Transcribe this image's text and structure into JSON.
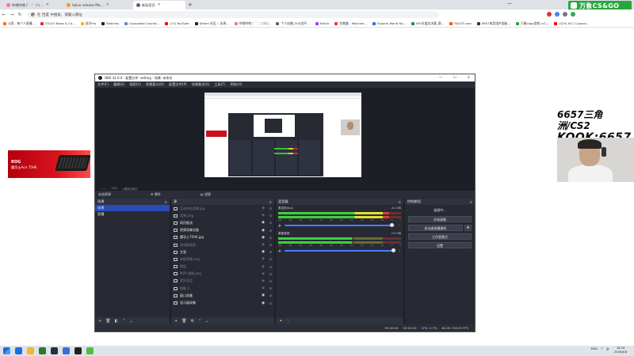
{
  "browser": {
    "tabs": [
      {
        "title": "哔哩哔哩 (゜-゜)つロ 干杯~-bilibili",
        "favicon_color": "#fb7299",
        "active": false
      },
      {
        "title": "Valve release Major identit...",
        "favicon_color": "#f0a01e",
        "active": false
      },
      {
        "title": "新标签页",
        "favicon_color": "#5f6368",
        "active": true
      }
    ],
    "omnibox_placeholder": "在 百度 中搜索，或输入网址",
    "bookmarks": [
      {
        "label": "斗鱼 - 每个人直播...",
        "color": "#ff6a00"
      },
      {
        "label": "CS:GO News & Co...",
        "color": "#d83131"
      },
      {
        "label": "虎牙Pro",
        "color": "#f6b600"
      },
      {
        "label": "Matches",
        "color": "#222222"
      },
      {
        "label": "Liquipedia Counte...",
        "color": "#6e89b6"
      },
      {
        "label": "(13) YouTube",
        "color": "#ff0000"
      },
      {
        "label": "Steam 社区 :: 本周...",
        "color": "#1b2838"
      },
      {
        "label": "哔哩哔哩 (゜-゜)つロ...",
        "color": "#fb7299"
      },
      {
        "label": "个人站播_SOS战平...",
        "color": "#666666"
      },
      {
        "label": "Twitch",
        "color": "#9146ff"
      },
      {
        "label": "完美趣 - Machine...",
        "color": "#e23b3b"
      },
      {
        "label": "Esports World Ra...",
        "color": "#3a6fd8"
      },
      {
        "label": "KPL年度总决赛_赛...",
        "color": "#2e8b57"
      },
      {
        "label": "FACEIT.com",
        "color": "#ff5500"
      },
      {
        "label": "6657电竞组件面板...",
        "color": "#333333"
      },
      {
        "label": "万象cogs游戏 (n2...",
        "color": "#2aa640"
      },
      {
        "label": "(425) HLC Cuprosi...",
        "color": "#ff0000"
      }
    ]
  },
  "overlay": {
    "site_logo": "万象CS&GO",
    "ad_brand": "ROG",
    "ad_text": "魔导士Ace 75HE",
    "stream_title_line1": "6657三角洲/CS2",
    "stream_title_line2": "KOOK:6657"
  },
  "obs": {
    "title": "OBS 32.0.4 - 配置文件: setting - 场景: 未命名",
    "menu": [
      "文件(F)",
      "编辑(E)",
      "视图(V)",
      "停靠窗口(D)",
      "配置文件(P)",
      "场景集合(S)",
      "工具(T)",
      "帮助(H)"
    ],
    "preview_footer": [
      "——",
      "16%",
      "| 缩放至窗口"
    ],
    "source_bar": {
      "no_source": "未选择源",
      "properties": "属性",
      "filters": "滤镜"
    },
    "docks": {
      "scenes_title": "场景",
      "sources_title": "源",
      "mixer_title": "混音器",
      "controls_title": "控制按钮"
    },
    "scenes": [
      {
        "name": "场景",
        "selected": true
      },
      {
        "name": "直播",
        "selected": false
      }
    ],
    "sources": [
      {
        "name": "互动冲击背景.jpg",
        "visible": false
      },
      {
        "name": "背景.png",
        "visible": false
      },
      {
        "name": "网页推流",
        "visible": true
      },
      {
        "name": "视频采集设备",
        "visible": true
      },
      {
        "name": "魔导士75HE.jpg",
        "visible": true
      },
      {
        "name": "游戏框架类",
        "visible": false
      },
      {
        "name": "文案",
        "visible": true
      },
      {
        "name": "哈根背景.png",
        "visible": false
      },
      {
        "name": "图层",
        "visible": false
      },
      {
        "name": "MVP-战绩.png",
        "visible": false
      },
      {
        "name": "竞技竞品",
        "visible": false
      },
      {
        "name": "图像 3",
        "visible": false
      },
      {
        "name": "窗口采集",
        "visible": true
      },
      {
        "name": "显示器采集",
        "visible": true
      }
    ],
    "mixer": [
      {
        "name": "麦克风/Aux",
        "db": "-4.1 dB",
        "level": 0.9,
        "volume": 0.97
      },
      {
        "name": "桌面音频",
        "db": "-0.2 dB",
        "level": 0.6,
        "volume": 0.98
      }
    ],
    "meter_ticks": [
      "-60",
      "-55",
      "-50",
      "-45",
      "-40",
      "-35",
      "-30",
      "-25",
      "-20",
      "-15",
      "-10",
      "-5",
      "0"
    ],
    "controls": {
      "status": "连接中...",
      "start_recording": "开始录制",
      "virtual_camera": "启动虚拟摄像机",
      "studio_mode": "工作室模式",
      "settings": "设置"
    },
    "status_bar": {
      "rec_time": "00:00:00",
      "stream_time": "00:00:00",
      "cpu": "CPU: 0.7%",
      "fps": "60.00 / 60.00 FPS"
    }
  },
  "taskbar": {
    "apps": [
      "#1e6fd9",
      "#f2b632",
      "#2b7a2b",
      "#2b2e38",
      "#3a6fd8",
      "#222222",
      "#4ec046"
    ],
    "tray": [
      "ENG"
    ],
    "time": "18:34",
    "date": "2026/4/8"
  }
}
